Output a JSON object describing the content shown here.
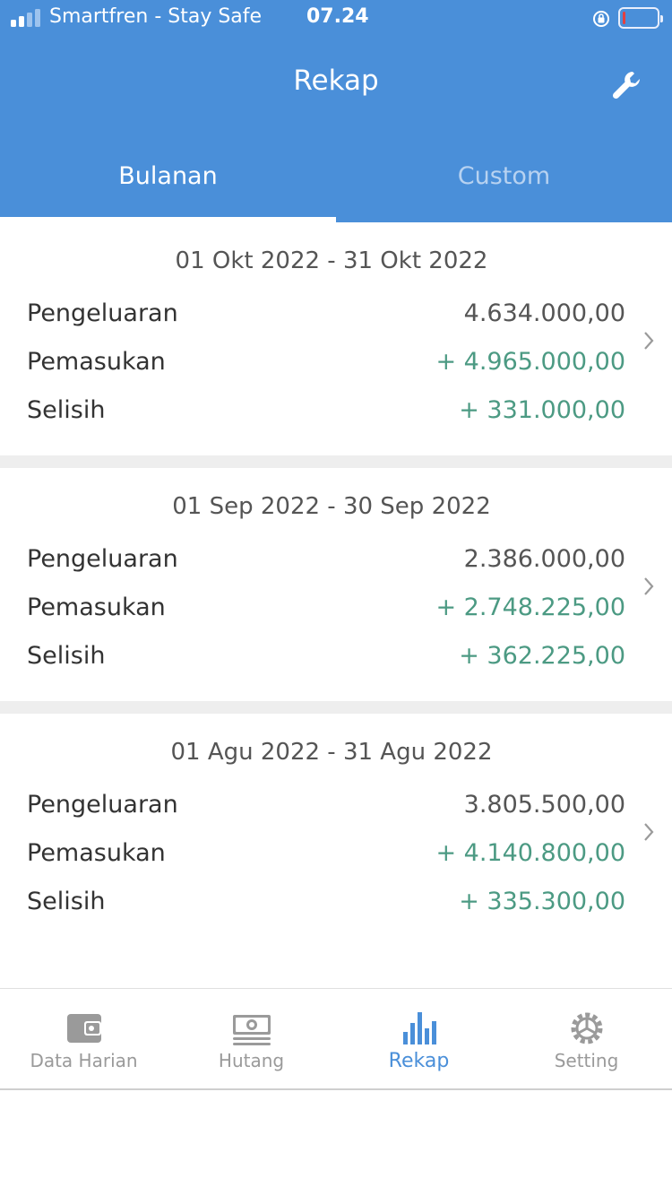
{
  "status_bar": {
    "carrier": "Smartfren - Stay Safe",
    "time": "07.24"
  },
  "header": {
    "title": "Rekap",
    "settings_icon": "wrench-icon"
  },
  "tabs": [
    {
      "label": "Bulanan",
      "active": true
    },
    {
      "label": "Custom",
      "active": false
    }
  ],
  "periods": [
    {
      "range": "01 Okt 2022 - 31 Okt 2022",
      "rows": [
        {
          "label": "Pengeluaran",
          "value": "4.634.000,00"
        },
        {
          "label": "Pemasukan",
          "value": "+ 4.965.000,00"
        },
        {
          "label": "Selisih",
          "value": "+ 331.000,00"
        }
      ]
    },
    {
      "range": "01 Sep 2022 - 30 Sep 2022",
      "rows": [
        {
          "label": "Pengeluaran",
          "value": "2.386.000,00"
        },
        {
          "label": "Pemasukan",
          "value": "+ 2.748.225,00"
        },
        {
          "label": "Selisih",
          "value": "+ 362.225,00"
        }
      ]
    },
    {
      "range": "01 Agu 2022 - 31 Agu 2022",
      "rows": [
        {
          "label": "Pengeluaran",
          "value": "3.805.500,00"
        },
        {
          "label": "Pemasukan",
          "value": "+ 4.140.800,00"
        },
        {
          "label": "Selisih",
          "value": "+ 335.300,00"
        }
      ]
    }
  ],
  "bottom_nav": [
    {
      "label": "Data Harian",
      "icon": "wallet-icon",
      "active": false
    },
    {
      "label": "Hutang",
      "icon": "money-icon",
      "active": false
    },
    {
      "label": "Rekap",
      "icon": "bar-chart-icon",
      "active": true
    },
    {
      "label": "Setting",
      "icon": "gear-icon",
      "active": false
    }
  ],
  "colors": {
    "primary": "#4a8fd9",
    "positive": "#4c9a83",
    "inactive": "#9a9a9a"
  }
}
